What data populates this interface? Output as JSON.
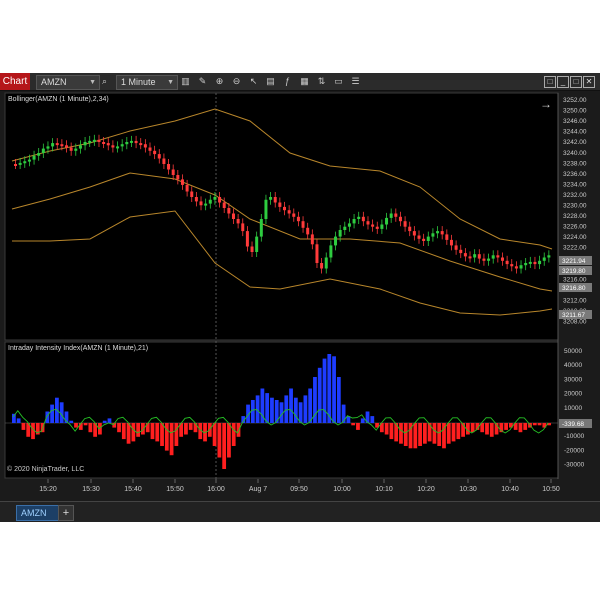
{
  "toolbar": {
    "chart_tab": "Chart",
    "instrument": "AMZN",
    "interval": "1 Minute",
    "icons": [
      "search-icon",
      "bar-type-icon",
      "pencil-icon",
      "zoom-in-icon",
      "zoom-out-icon",
      "cursor-icon",
      "properties-icon",
      "indicators-icon",
      "strategies-icon",
      "chart-trader-icon",
      "data-box-icon"
    ],
    "window_buttons": [
      "□",
      "_",
      "□",
      "✕"
    ]
  },
  "price_panel": {
    "label": "Bollinger(AMZN (1 Minute),2,34)",
    "ticks": [
      "3252.00",
      "3250.00",
      "3246.00",
      "3244.00",
      "3242.00",
      "3240.00",
      "3238.00",
      "3236.00",
      "3234.00",
      "3232.00",
      "3230.00",
      "3228.00",
      "3226.00",
      "3224.00",
      "3222.00",
      "3220.00",
      "3218.00",
      "3216.00",
      "3214.00",
      "3212.00",
      "3210.00",
      "3208.00"
    ],
    "badges": [
      {
        "text": "3221.94",
        "color": "#7a7a7a"
      },
      {
        "text": "3219.80",
        "color": "#7a7a7a"
      },
      {
        "text": "3216.80",
        "color": "#7a7a7a"
      },
      {
        "text": "3211.67",
        "color": "#7a7a7a"
      }
    ]
  },
  "iii_panel": {
    "label": "Intraday Intensity Index(AMZN (1 Minute),21)",
    "ticks": [
      "50000",
      "40000",
      "30000",
      "20000",
      "10000",
      "0",
      "-10000",
      "-20000",
      "-30000"
    ],
    "badge": "-339.68",
    "copyright": "© 2020 NinjaTrader, LLC"
  },
  "time_axis": {
    "labels": [
      "15:20",
      "15:30",
      "15:40",
      "15:50",
      "16:00",
      "Aug 7",
      "09:50",
      "10:00",
      "10:10",
      "10:20",
      "10:30",
      "10:40",
      "10:50"
    ]
  },
  "bottom_tabs": {
    "active": "AMZN",
    "add": "+"
  },
  "colors": {
    "up": "#2ecc40",
    "down": "#ff3b3b",
    "band": "#b8862b",
    "pos_bar": "#1e3cff",
    "neg_bar": "#ff1f1f",
    "signal_line": "#25c025"
  }
}
